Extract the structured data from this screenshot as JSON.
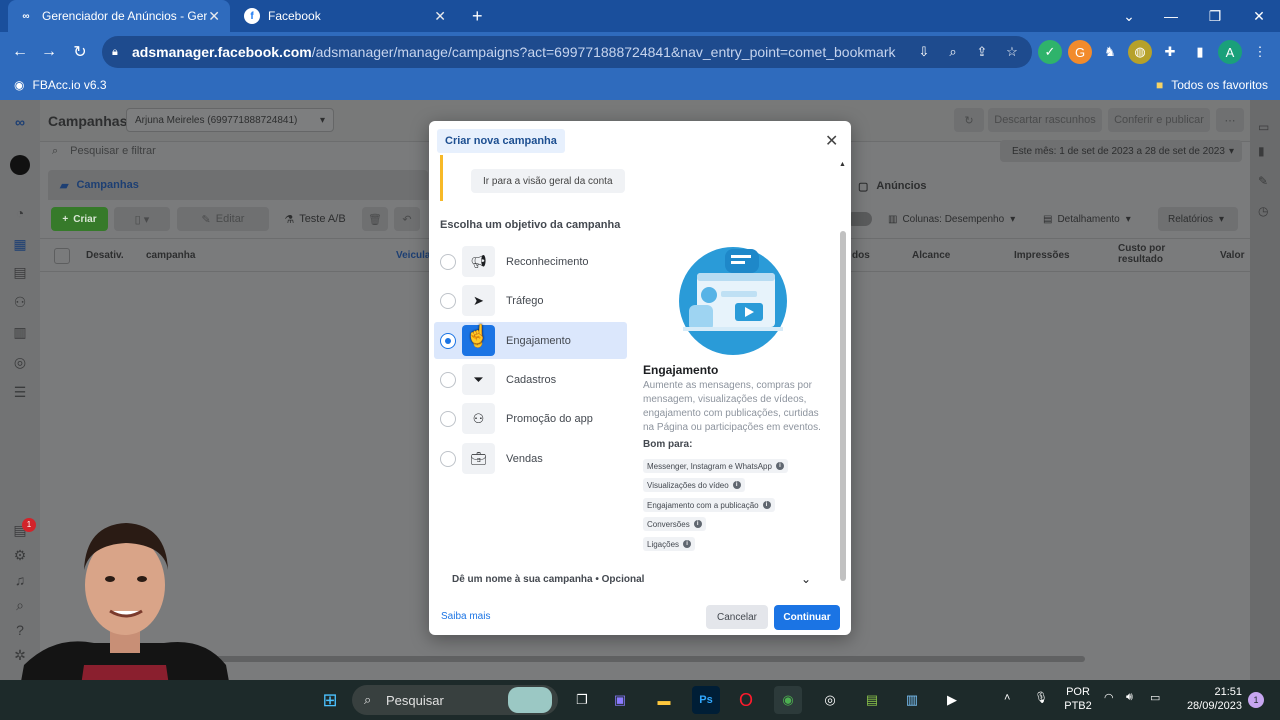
{
  "browser": {
    "tabs": [
      {
        "title": "Gerenciador de Anúncios - Gere",
        "active": true,
        "icon": "meta-icon"
      },
      {
        "title": "Facebook",
        "active": false,
        "icon": "facebook-icon"
      }
    ],
    "url_host": "adsmanager.facebook.com",
    "url_path": "/adsmanager/manage/campaigns?act=699771888724841&nav_entry_point=comet_bookmark",
    "profile_initial": "A",
    "bookmarks": {
      "left": "FBAcc.io v6.3",
      "right": "Todos os favoritos"
    }
  },
  "ads_manager": {
    "title": "Campanhas",
    "account_selector": "Arjuna Meireles (699771888724841)",
    "search_placeholder": "Pesquisar e filtrar",
    "discard_label": "Descartar rascunhos",
    "review_label": "Conferir e publicar",
    "date_range": "Este mês: 1 de set de 2023 a 28 de set de 2023",
    "tab_campaigns": "Campanhas",
    "tab_ads": "Anúncios",
    "create_label": "Criar",
    "edit_label": "Editar",
    "ab_test_label": "Teste A/B",
    "columns_label": "Colunas: Desempenho",
    "breakdown_label": "Detalhamento",
    "reports_label": "Relatórios",
    "table_headers": [
      "Desativ.",
      "campanha",
      "Veicula",
      "dos",
      "Alcance",
      "Impressões",
      "Custo por resultado",
      "Valor"
    ],
    "notification_count": "1"
  },
  "modal": {
    "title": "Criar nova campanha",
    "overview_button": "Ir para a visão geral da conta",
    "section_title": "Escolha um objetivo da campanha",
    "objectives": [
      {
        "label": "Reconhecimento",
        "icon": "megaphone-icon",
        "selected": false
      },
      {
        "label": "Tráfego",
        "icon": "cursor-icon",
        "selected": false
      },
      {
        "label": "Engajamento",
        "icon": "hand-pointer-icon",
        "selected": true
      },
      {
        "label": "Cadastros",
        "icon": "funnel-icon",
        "selected": false
      },
      {
        "label": "Promoção do app",
        "icon": "people-icon",
        "selected": false
      },
      {
        "label": "Vendas",
        "icon": "briefcase-icon",
        "selected": false
      }
    ],
    "detail_title": "Engajamento",
    "detail_description": "Aumente as mensagens, compras por mensagem, visualizações de vídeos, engajamento com publicações, curtidas na Página ou participações em eventos.",
    "good_for_label": "Bom para:",
    "good_for": [
      "Messenger, Instagram e WhatsApp",
      "Visualizações do vídeo",
      "Engajamento com a publicação",
      "Conversões",
      "Ligações"
    ],
    "name_row": "Dê um nome à sua campanha • Opcional",
    "learn_more": "Saiba mais",
    "cancel": "Cancelar",
    "continue": "Continuar"
  },
  "taskbar": {
    "search_label": "Pesquisar",
    "lang_top": "POR",
    "lang_bottom": "PTB2",
    "time": "21:51",
    "date": "28/09/2023",
    "notification_badge": "1"
  },
  "colors": {
    "accent": "#1b74e4",
    "chrome_blue": "#2f6bbd",
    "create_green": "#42b72a"
  }
}
